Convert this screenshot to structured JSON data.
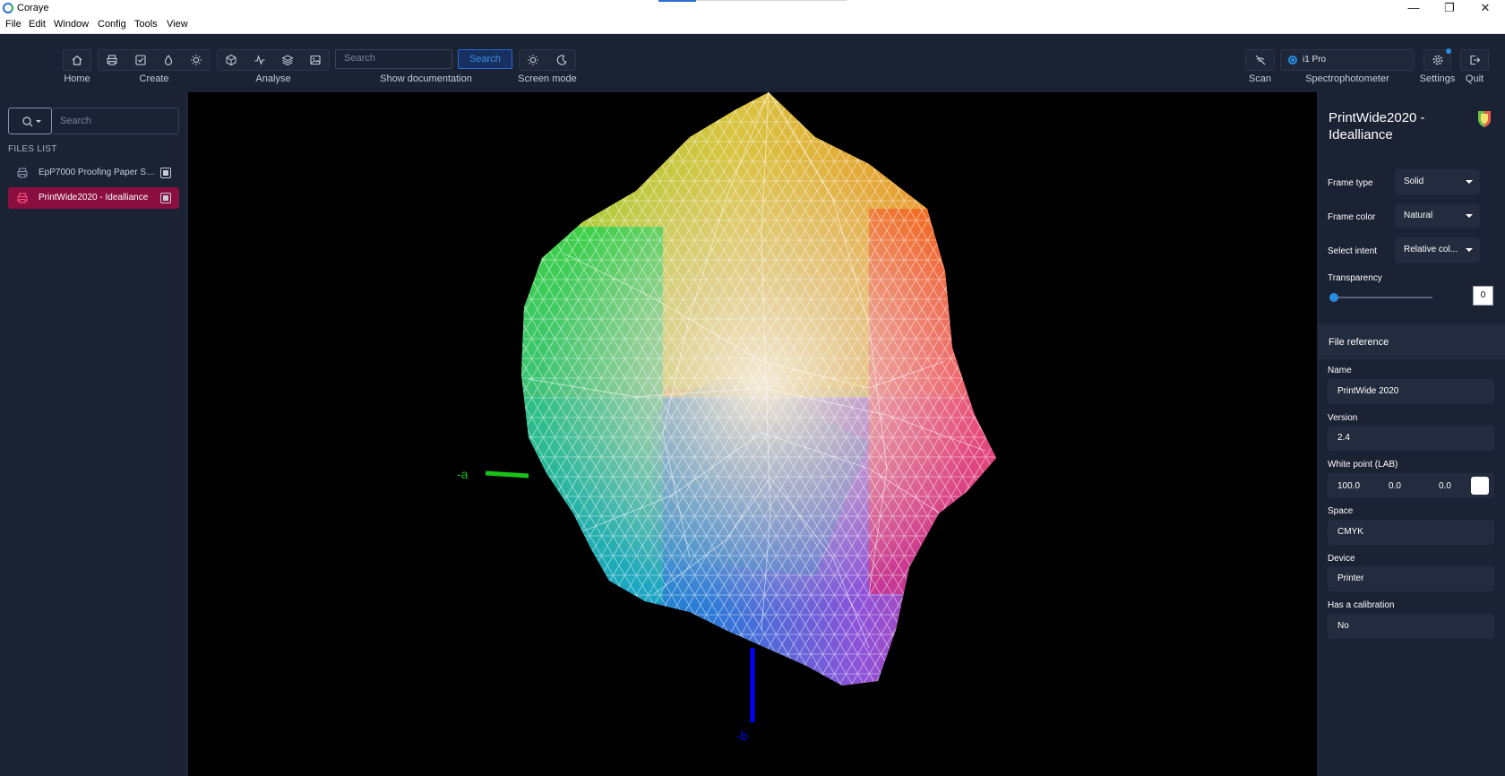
{
  "window": {
    "title": "Coraye",
    "controls": {
      "minimize": "—",
      "maximize": "❐",
      "close": "✕"
    }
  },
  "menu": {
    "items": [
      "File",
      "Edit",
      "Window",
      "Config",
      "Tools",
      "View"
    ]
  },
  "toolbar": {
    "home_label": "Home",
    "create_label": "Create",
    "analyse_label": "Analyse",
    "search_placeholder": "Search",
    "search_button": "Search",
    "show_doc_label": "Show documentation",
    "screen_mode_label": "Screen mode",
    "scan_label": "Scan",
    "device_name": "i1 Pro",
    "spectro_label": "Spectrophotometer",
    "settings_label": "Settings",
    "quit_label": "Quit"
  },
  "sidebar": {
    "search_placeholder": "Search",
    "files_title": "FILES LIST",
    "files": [
      {
        "name": "EpP7000 Proofing Paper SG ...",
        "selected": false
      },
      {
        "name": "PrintWide2020 - Idealliance",
        "selected": true
      }
    ]
  },
  "viewer": {
    "axes": {
      "neg_a": "-a",
      "neg_b": "-b"
    },
    "colors": {
      "a_axis": "#19c219",
      "b_axis": "#0000ff"
    }
  },
  "panel": {
    "title": "PrintWide2020 - Idealliance",
    "frame_type_label": "Frame type",
    "frame_type_value": "Solid",
    "frame_color_label": "Frame color",
    "frame_color_value": "Natural",
    "intent_label": "Select intent",
    "intent_value": "Relative col...",
    "transparency_label": "Transparency",
    "transparency_value": "0",
    "file_reference_title": "File reference",
    "name_label": "Name",
    "name_value": "PrintWide 2020",
    "version_label": "Version",
    "version_value": "2.4",
    "white_point_label": "White point (LAB)",
    "white_point": [
      "100.0",
      "0.0",
      "0.0"
    ],
    "space_label": "Space",
    "space_value": "CMYK",
    "device_label": "Device",
    "device_value": "Printer",
    "calibration_label": "Has a calibration",
    "calibration_value": "No"
  },
  "colors": {
    "accent": "#2a8be0",
    "selected_file": "#8a0f3e",
    "background": "#1a2233"
  }
}
